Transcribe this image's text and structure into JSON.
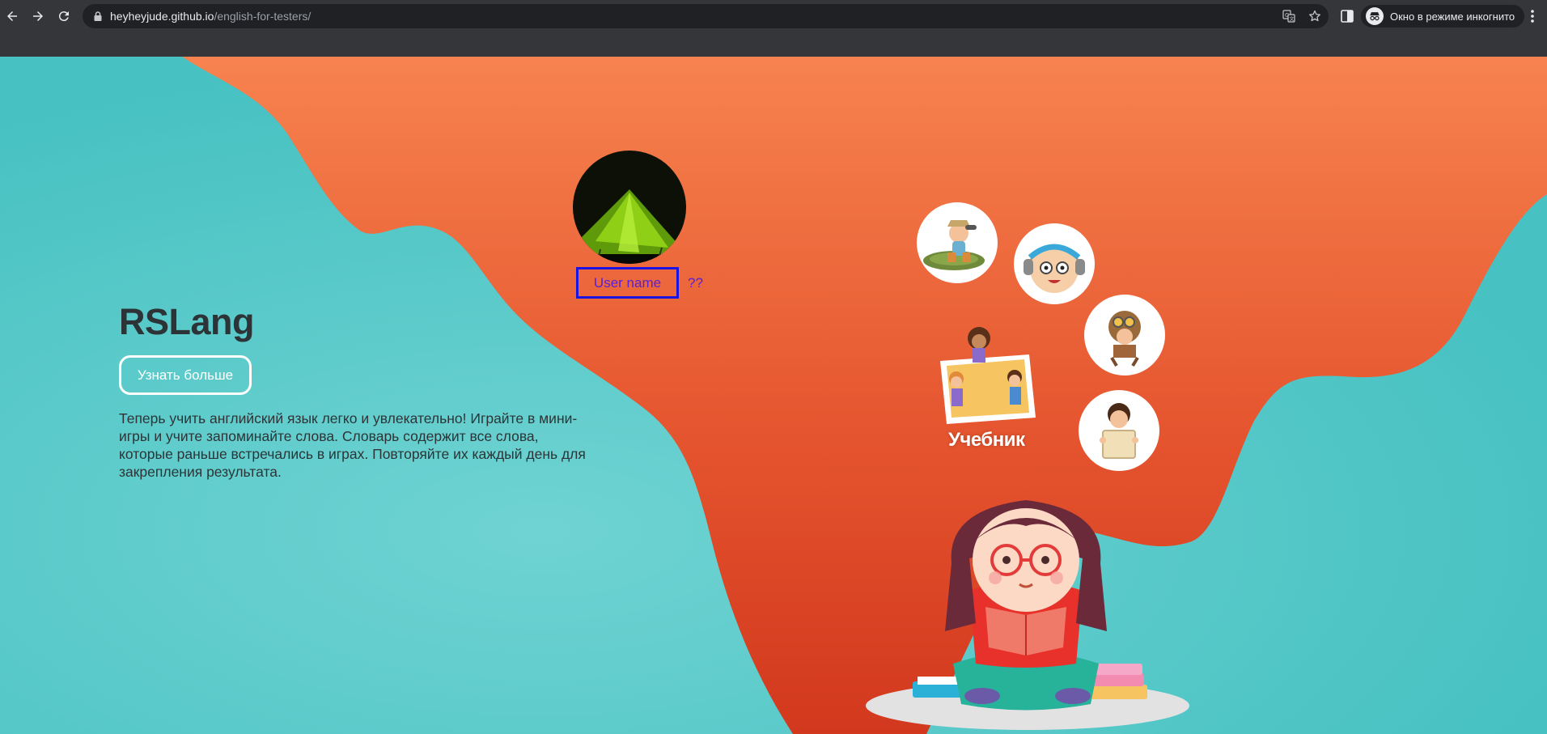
{
  "browser": {
    "url_host": "heyheyjude.github.io",
    "url_path": "/english-for-testers/",
    "incognito_label": "Окно в режиме инкогнито",
    "icons": [
      "back-arrow-icon",
      "forward-arrow-icon",
      "reload-icon",
      "lock-icon",
      "translate-icon",
      "bookmark-star-icon",
      "side-panel-icon",
      "incognito-icon",
      "more-menu-icon"
    ]
  },
  "hero": {
    "title": "RSLang",
    "more_button": "Узнать больше",
    "description": "Теперь учить английский язык легко и увлекательно! Играйте в мини-игры и учите запоминайте слова. Словарь содержит все слова, которые раньше встречались в играх. Повторяйте их каждый день для закрепления результата."
  },
  "user": {
    "name_button": "User name",
    "extra": "??"
  },
  "navigation": {
    "textbook_label": "Учебник",
    "game_icons": [
      "explorer-kid-icon",
      "headphones-girl-icon",
      "pilot-kid-icon",
      "sign-boy-icon"
    ]
  },
  "colors": {
    "teal_background": "#4cc3c4",
    "orange_top": "#f7834f",
    "orange_bottom": "#d63a1e",
    "user_box_border": "#1b14e0",
    "text_dark": "#2d3437"
  }
}
